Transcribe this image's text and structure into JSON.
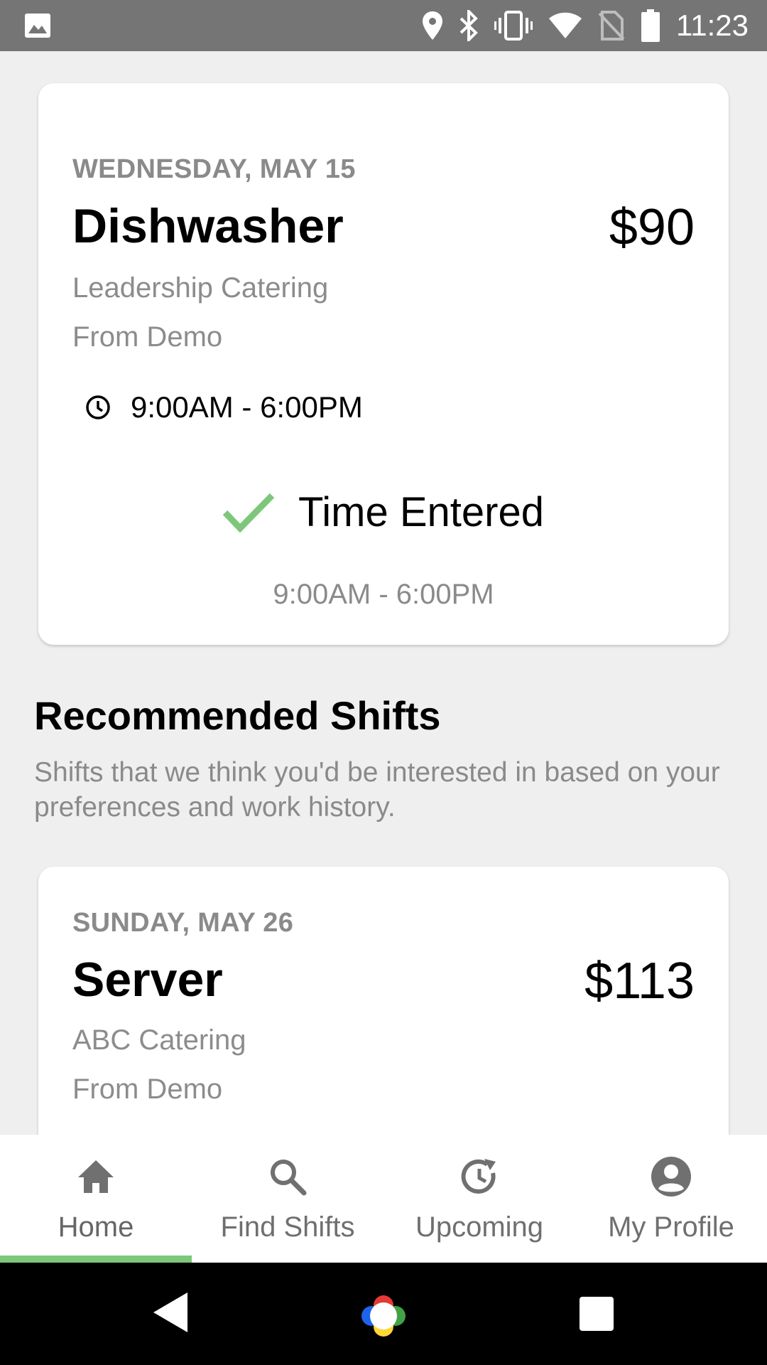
{
  "status_bar": {
    "time": "11:23",
    "icons": [
      "image-icon",
      "location-icon",
      "bluetooth-icon",
      "vibrate-icon",
      "wifi-icon",
      "no-sim-icon",
      "battery-icon"
    ]
  },
  "current_shift": {
    "date": "WEDNESDAY, MAY 15",
    "role": "Dishwasher",
    "pay": "$90",
    "company": "Leadership Catering",
    "source": "From Demo",
    "time_range": "9:00AM - 6:00PM",
    "status_label": "Time Entered",
    "entered_time": "9:00AM - 6:00PM"
  },
  "recommended": {
    "title": "Recommended Shifts",
    "description": "Shifts that we think you'd be interested in based on your preferences and work history."
  },
  "recommended_shift": {
    "date": "SUNDAY, MAY 26",
    "role": "Server",
    "pay": "$113",
    "company": "ABC Catering",
    "source": "From Demo"
  },
  "bottom_nav": {
    "items": [
      {
        "label": "Home",
        "icon": "home-icon",
        "active": true
      },
      {
        "label": "Find Shifts",
        "icon": "search-icon",
        "active": false
      },
      {
        "label": "Upcoming",
        "icon": "history-icon",
        "active": false
      },
      {
        "label": "My Profile",
        "icon": "profile-icon",
        "active": false
      }
    ]
  },
  "colors": {
    "accent": "#7dc77a",
    "status_bar": "#757575",
    "secondary_text": "#8a8a8a",
    "background": "#efefef"
  }
}
